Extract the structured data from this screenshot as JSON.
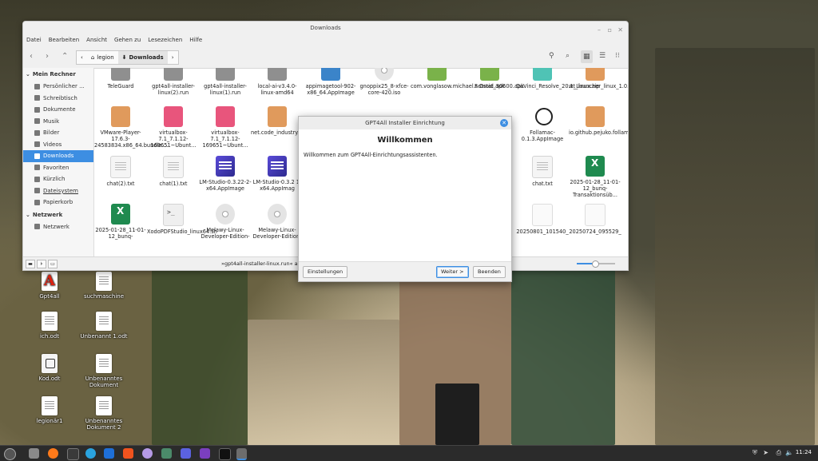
{
  "file_manager": {
    "title": "Downloads",
    "menu": [
      "Datei",
      "Bearbeiten",
      "Ansicht",
      "Gehen zu",
      "Lesezeichen",
      "Hilfe"
    ],
    "breadcrumb": [
      "legion",
      "Downloads"
    ],
    "sidebar": {
      "computer_header": "Mein Rechner",
      "computer_items": [
        "Persönlicher ...",
        "Schreibtisch",
        "Dokumente",
        "Musik",
        "Bilder",
        "Videos",
        "Downloads",
        "Favoriten",
        "Kürzlich",
        "Dateisystem",
        "Papierkorb"
      ],
      "network_header": "Netzwerk",
      "network_items": [
        "Netzwerk"
      ]
    },
    "files": [
      {
        "name": "TeleGuard",
        "icon": "gray"
      },
      {
        "name": "gpt4all-installer-linux(2).run",
        "icon": "gray"
      },
      {
        "name": "gpt4all-installer-linux(1).run",
        "icon": "gray"
      },
      {
        "name": "local-ai-v3.4.0-linux-amd64",
        "icon": "gray"
      },
      {
        "name": "appimagetool-902-x86_64.AppImage",
        "icon": "blue"
      },
      {
        "name": "gnoppix25_8-xfce-core-420.iso",
        "icon": "cd"
      },
      {
        "name": "com.vonglasow.michael.satstat_30600.apk",
        "icon": "green"
      },
      {
        "name": "F-Droid.apk",
        "icon": "green"
      },
      {
        "name": "DaVinci_Resolve_20.1_Linux.zip",
        "icon": "teal"
      },
      {
        "name": "wt_launcher_linux_1.0.3.26.tar.gz",
        "icon": "pkg"
      },
      {
        "name": "VMware-Player-17.6.3-24583834.x86_64.bundle....",
        "icon": "pkg"
      },
      {
        "name": "virtualbox-7.1_7.1.12-169651~Ubunt...",
        "icon": "pink"
      },
      {
        "name": "virtualbox-7.1_7.1.12-169651~Ubunt...",
        "icon": "pink"
      },
      {
        "name": "net.code_industry.MasterPDFEdito...",
        "icon": "pkg"
      },
      {
        "name": "Follamac-0.1.3.AppImage",
        "icon": "robot"
      },
      {
        "name": "io.github.pejuko.follamac.flatpakref",
        "icon": "pkg"
      },
      {
        "name": "chat(2).txt",
        "icon": "txt"
      },
      {
        "name": "chat(1).txt",
        "icon": "txt"
      },
      {
        "name": "LM-Studio-0.3.22-2-x64.AppImage",
        "icon": "lm"
      },
      {
        "name": "LM-Studio-0.3.2 1-x64.AppImag",
        "icon": "lm"
      },
      {
        "name": "chat.txt",
        "icon": "txt"
      },
      {
        "name": "2025-01-28_11-01-12_bunq-Transaktionsüb...",
        "icon": "xls"
      },
      {
        "name": "2025-01-28_11-01-12_bunq-",
        "icon": "xls"
      },
      {
        "name": "XodoPDFStudio_linux64.sh",
        "icon": "sh"
      },
      {
        "name": "Melawy-Linux-Developer-Edition-",
        "icon": "cd"
      },
      {
        "name": "Melawy-Linux-Developer-Edition-",
        "icon": "cd"
      },
      {
        "name": "20250801_101540_",
        "icon": "pdf"
      },
      {
        "name": "20250724_095529_",
        "icon": "pdf"
      }
    ],
    "status_text": "»gpt4all-installer-linux.run« au"
  },
  "dialog": {
    "title": "GPT4All Installer Einrichtung",
    "heading": "Willkommen",
    "text": "Willkommen zum GPT4All-Einrichtungsassistenten.",
    "settings_button": "Einstellungen",
    "next_button": "Weiter >",
    "finish_button": "Beenden"
  },
  "desktop_icons": [
    "Gpt4all",
    "suchmaschine",
    "ich.odt",
    "Unbenannt 1.odt",
    "Kod.odt",
    "Unbenanntes Dokument",
    "legionär1",
    "Unbenanntes Dokument 2"
  ],
  "taskbar": {
    "clock": "11:24"
  }
}
